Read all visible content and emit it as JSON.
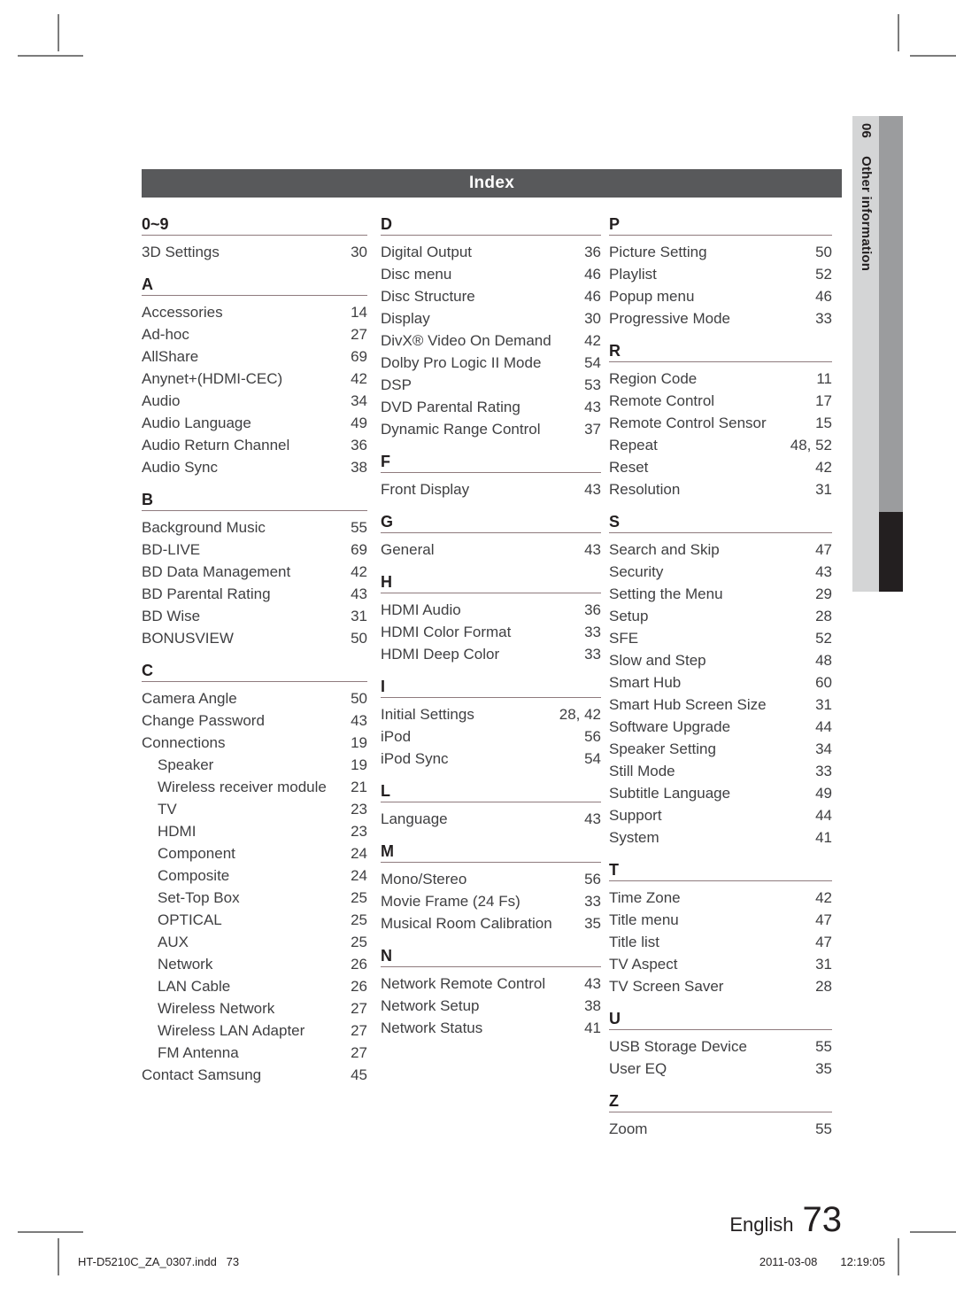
{
  "header": {
    "title": "Index"
  },
  "side_tab": {
    "chapter_number": "06",
    "chapter_label": "Other information"
  },
  "colors": {
    "header_bar": "#58595b",
    "tab_strip": "#d4d5d6",
    "tab_bar_grey": "#9b9c9e",
    "tab_bar_dark": "#231f20",
    "rule": "#8f7b7e",
    "text": "#3f3f41"
  },
  "columns": [
    {
      "blocks": [
        {
          "letter": "0~9",
          "entries": [
            {
              "label": "3D Settings",
              "page": "30",
              "indent": false
            }
          ]
        },
        {
          "letter": "A",
          "entries": [
            {
              "label": "Accessories",
              "page": "14",
              "indent": false
            },
            {
              "label": "Ad-hoc",
              "page": "27",
              "indent": false
            },
            {
              "label": "AllShare",
              "page": "69",
              "indent": false
            },
            {
              "label": "Anynet+(HDMI-CEC)",
              "page": "42",
              "indent": false
            },
            {
              "label": "Audio",
              "page": "34",
              "indent": false
            },
            {
              "label": "Audio Language",
              "page": "49",
              "indent": false
            },
            {
              "label": "Audio Return Channel",
              "page": "36",
              "indent": false
            },
            {
              "label": "Audio Sync",
              "page": "38",
              "indent": false
            }
          ]
        },
        {
          "letter": "B",
          "entries": [
            {
              "label": "Background Music",
              "page": "55",
              "indent": false
            },
            {
              "label": "BD-LIVE",
              "page": "69",
              "indent": false
            },
            {
              "label": "BD Data Management",
              "page": "42",
              "indent": false
            },
            {
              "label": "BD Parental Rating",
              "page": "43",
              "indent": false
            },
            {
              "label": "BD Wise",
              "page": "31",
              "indent": false
            },
            {
              "label": "BONUSVIEW",
              "page": "50",
              "indent": false
            }
          ]
        },
        {
          "letter": "C",
          "entries": [
            {
              "label": "Camera Angle",
              "page": "50",
              "indent": false
            },
            {
              "label": "Change Password",
              "page": "43",
              "indent": false
            },
            {
              "label": "Connections",
              "page": "19",
              "indent": false
            },
            {
              "label": "Speaker",
              "page": "19",
              "indent": true
            },
            {
              "label": "Wireless receiver module",
              "page": "21",
              "indent": true
            },
            {
              "label": "TV",
              "page": "23",
              "indent": true
            },
            {
              "label": "HDMI",
              "page": "23",
              "indent": true
            },
            {
              "label": "Component",
              "page": "24",
              "indent": true
            },
            {
              "label": "Composite",
              "page": "24",
              "indent": true
            },
            {
              "label": "Set-Top Box",
              "page": "25",
              "indent": true
            },
            {
              "label": "OPTICAL",
              "page": "25",
              "indent": true
            },
            {
              "label": "AUX",
              "page": "25",
              "indent": true
            },
            {
              "label": "Network",
              "page": "26",
              "indent": true
            },
            {
              "label": "LAN Cable",
              "page": "26",
              "indent": true
            },
            {
              "label": "Wireless Network",
              "page": "27",
              "indent": true
            },
            {
              "label": "Wireless LAN Adapter",
              "page": "27",
              "indent": true
            },
            {
              "label": "FM Antenna",
              "page": "27",
              "indent": true
            },
            {
              "label": "Contact Samsung",
              "page": "45",
              "indent": false
            }
          ]
        }
      ]
    },
    {
      "blocks": [
        {
          "letter": "D",
          "entries": [
            {
              "label": "Digital Output",
              "page": "36",
              "indent": false
            },
            {
              "label": "Disc menu",
              "page": "46",
              "indent": false
            },
            {
              "label": "Disc Structure",
              "page": "46",
              "indent": false
            },
            {
              "label": "Display",
              "page": "30",
              "indent": false
            },
            {
              "label": "DivX® Video On Demand",
              "page": "42",
              "indent": false
            },
            {
              "label": "Dolby Pro Logic II Mode",
              "page": "54",
              "indent": false
            },
            {
              "label": "DSP",
              "page": "53",
              "indent": false
            },
            {
              "label": "DVD Parental Rating",
              "page": "43",
              "indent": false
            },
            {
              "label": "Dynamic Range Control",
              "page": "37",
              "indent": false
            }
          ]
        },
        {
          "letter": "F",
          "entries": [
            {
              "label": "Front Display",
              "page": "43",
              "indent": false
            }
          ]
        },
        {
          "letter": "G",
          "entries": [
            {
              "label": "General",
              "page": "43",
              "indent": false
            }
          ]
        },
        {
          "letter": "H",
          "entries": [
            {
              "label": "HDMI Audio",
              "page": "36",
              "indent": false
            },
            {
              "label": "HDMI Color Format",
              "page": "33",
              "indent": false
            },
            {
              "label": "HDMI Deep Color",
              "page": "33",
              "indent": false
            }
          ]
        },
        {
          "letter": "I",
          "entries": [
            {
              "label": "Initial Settings",
              "page": "28, 42",
              "indent": false
            },
            {
              "label": "iPod",
              "page": "56",
              "indent": false
            },
            {
              "label": "iPod Sync",
              "page": "54",
              "indent": false
            }
          ]
        },
        {
          "letter": "L",
          "entries": [
            {
              "label": "Language",
              "page": "43",
              "indent": false
            }
          ]
        },
        {
          "letter": "M",
          "entries": [
            {
              "label": "Mono/Stereo",
              "page": "56",
              "indent": false
            },
            {
              "label": "Movie Frame (24 Fs)",
              "page": "33",
              "indent": false
            },
            {
              "label": "Musical Room Calibration",
              "page": "35",
              "indent": false
            }
          ]
        },
        {
          "letter": "N",
          "entries": [
            {
              "label": "Network Remote Control",
              "page": "43",
              "indent": false
            },
            {
              "label": "Network Setup",
              "page": "38",
              "indent": false
            },
            {
              "label": "Network Status",
              "page": "41",
              "indent": false
            }
          ]
        }
      ]
    },
    {
      "blocks": [
        {
          "letter": "P",
          "entries": [
            {
              "label": "Picture Setting",
              "page": "50",
              "indent": false
            },
            {
              "label": "Playlist",
              "page": "52",
              "indent": false
            },
            {
              "label": "Popup menu",
              "page": "46",
              "indent": false
            },
            {
              "label": "Progressive Mode",
              "page": "33",
              "indent": false
            }
          ]
        },
        {
          "letter": "R",
          "entries": [
            {
              "label": "Region Code",
              "page": "11",
              "indent": false
            },
            {
              "label": "Remote Control",
              "page": "17",
              "indent": false
            },
            {
              "label": "Remote Control Sensor",
              "page": "15",
              "indent": false
            },
            {
              "label": "Repeat",
              "page": "48, 52",
              "indent": false
            },
            {
              "label": "Reset",
              "page": "42",
              "indent": false
            },
            {
              "label": "Resolution",
              "page": "31",
              "indent": false
            }
          ]
        },
        {
          "letter": "S",
          "entries": [
            {
              "label": "Search and Skip",
              "page": "47",
              "indent": false
            },
            {
              "label": "Security",
              "page": "43",
              "indent": false
            },
            {
              "label": "Setting the Menu",
              "page": "29",
              "indent": false
            },
            {
              "label": "Setup",
              "page": "28",
              "indent": false
            },
            {
              "label": "SFE",
              "page": "52",
              "indent": false
            },
            {
              "label": "Slow and Step",
              "page": "48",
              "indent": false
            },
            {
              "label": "Smart Hub",
              "page": "60",
              "indent": false
            },
            {
              "label": "Smart Hub Screen Size",
              "page": "31",
              "indent": false
            },
            {
              "label": "Software Upgrade",
              "page": "44",
              "indent": false
            },
            {
              "label": "Speaker Setting",
              "page": "34",
              "indent": false
            },
            {
              "label": "Still Mode",
              "page": "33",
              "indent": false
            },
            {
              "label": "Subtitle Language",
              "page": "49",
              "indent": false
            },
            {
              "label": "Support",
              "page": "44",
              "indent": false
            },
            {
              "label": "System",
              "page": "41",
              "indent": false
            }
          ]
        },
        {
          "letter": "T",
          "entries": [
            {
              "label": "Time Zone",
              "page": "42",
              "indent": false
            },
            {
              "label": "Title menu",
              "page": "47",
              "indent": false
            },
            {
              "label": "Title list",
              "page": "47",
              "indent": false
            },
            {
              "label": "TV Aspect",
              "page": "31",
              "indent": false
            },
            {
              "label": "TV Screen Saver",
              "page": "28",
              "indent": false
            }
          ]
        },
        {
          "letter": "U",
          "entries": [
            {
              "label": "USB Storage Device",
              "page": "55",
              "indent": false
            },
            {
              "label": "User EQ",
              "page": "35",
              "indent": false
            }
          ]
        },
        {
          "letter": "Z",
          "entries": [
            {
              "label": "Zoom",
              "page": "55",
              "indent": false
            }
          ]
        }
      ]
    }
  ],
  "footer": {
    "language": "English",
    "page_number": "73"
  },
  "print_meta": {
    "filename": "HT-D5210C_ZA_0307.indd   73",
    "date": "2011-03-08",
    "time": "12:19:05"
  }
}
